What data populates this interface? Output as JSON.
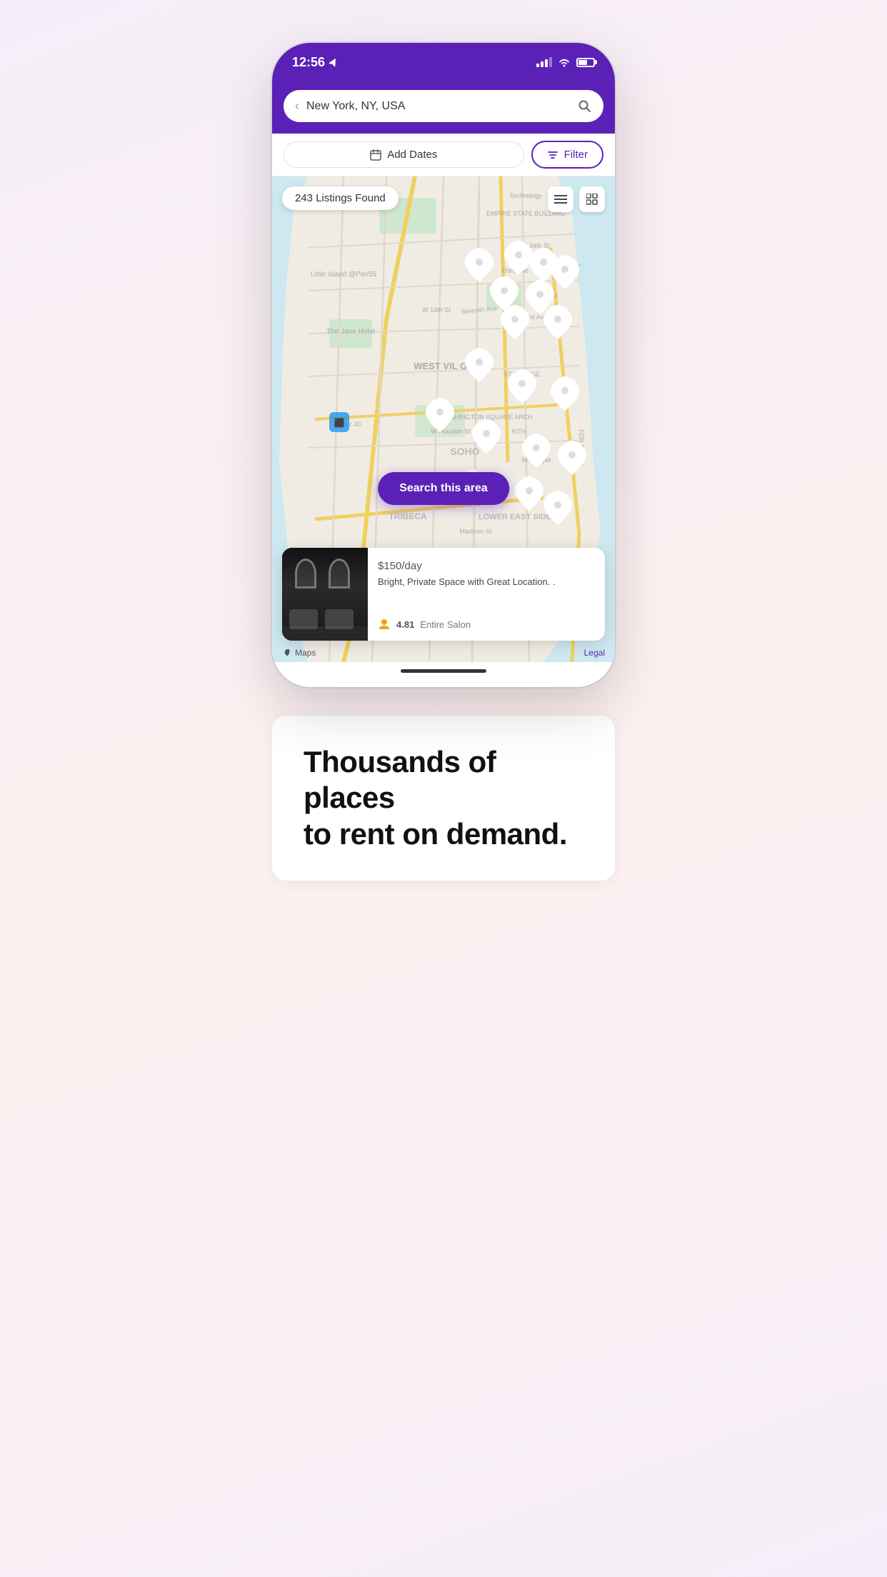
{
  "status_bar": {
    "time": "12:56",
    "location_arrow": "✈",
    "signal_strength": 3,
    "wifi": true,
    "battery_pct": 60
  },
  "search_bar": {
    "back_label": "‹",
    "location_text": "New York, NY, USA",
    "search_icon_label": "🔍"
  },
  "filter_bar": {
    "add_dates_label": "Add Dates",
    "calendar_icon": "📅",
    "filter_label": "Filter",
    "filter_icon": "⚙"
  },
  "map": {
    "listings_badge": "243 Listings Found",
    "list_view_icon": "≡",
    "grid_view_icon": "⊞",
    "search_area_btn": "Search this area",
    "maps_attribution": "Maps",
    "legal_label": "Legal"
  },
  "listing_card": {
    "price": "$150",
    "price_unit": "/day",
    "title": "Bright, Private Space with Great Location. .",
    "rating": "4.81",
    "type": "Entire Salon"
  },
  "tagline": {
    "line1": "Thousands of places",
    "line2": "to rent on demand."
  }
}
